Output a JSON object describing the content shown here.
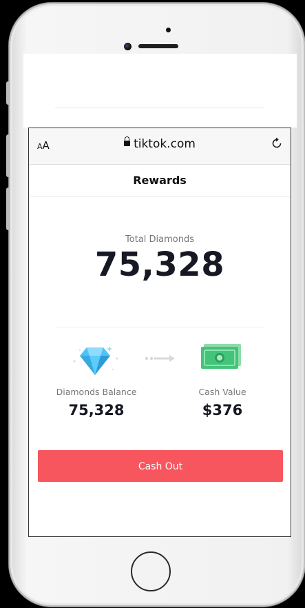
{
  "browser": {
    "aa_small": "A",
    "aa_large": "A",
    "domain": "tiktok.com",
    "reload_icon": "reload-icon"
  },
  "page": {
    "title": "Rewards",
    "total_label": "Total Diamonds",
    "total_value": "75,328",
    "diamonds_label": "Diamonds Balance",
    "diamonds_value": "75,328",
    "cash_label": "Cash Value",
    "cash_value": "$376",
    "cashout_label": "Cash Out"
  },
  "colors": {
    "cashout": "#f7565e",
    "diamond": "#4fc3f7",
    "cash": "#43c47a"
  }
}
